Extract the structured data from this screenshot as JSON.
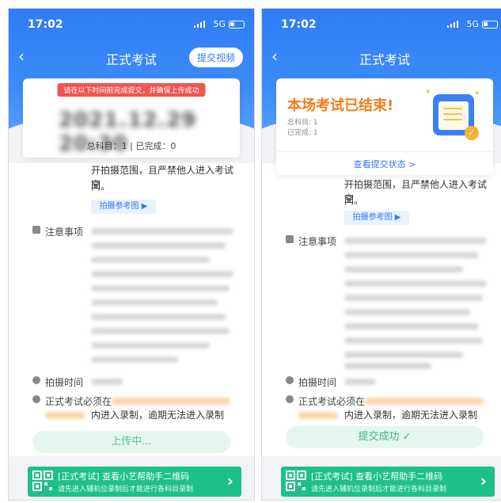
{
  "left": {
    "status_time": "17:02",
    "network": "5G",
    "nav_title": "正式考试",
    "submit_video_label": "提交视频",
    "notice": "请在以下时间前完成提交，并确保上传成功",
    "deadline_blurred": "2021.12.29 20:30",
    "counts": "总科目：1  |  已完成：0",
    "body_partial_line1": "开拍摄范围，且严禁他人进入考试空",
    "body_partial_line2": "间。",
    "ref_photo_label": "拍摄参考图 ▶",
    "notes_label": "注意事项",
    "shoot_time_label": "拍摄时间",
    "must_label": "正式考试必须在",
    "must_tail": "内进入录制，逾期无法进入录制",
    "action_label": "上传中...",
    "banner_title": "[正式考试] 查看小艺帮助手二维码",
    "banner_sub": "请先进入辅机位录制后才能进行各科目录制"
  },
  "right": {
    "status_time": "17:02",
    "network": "5G",
    "nav_title": "正式考试",
    "ended_title": "本场考试已结束!",
    "total_label": "总科目: 1",
    "done_label": "已完成: 1",
    "status_link": "查看提交状态 >",
    "body_partial_line1": "开拍摄范围，且严禁他人进入考试空",
    "body_partial_line2": "间。",
    "ref_photo_label": "拍摄参考图 ▶",
    "notes_label": "注意事项",
    "shoot_time_label": "拍摄时间",
    "must_label": "正式考试必须在",
    "must_tail": "内进入录制，逾期无法进入录制",
    "action_label": "提交成功 ✓",
    "banner_title": "[正式考试] 查看小艺帮助手二维码",
    "banner_sub": "请先进入辅机位录制后才能进行各科目录制"
  },
  "colors": {
    "brand_blue": "#2f7cf6",
    "success_green": "#1ec089",
    "warning_orange": "#f07d1a",
    "notice_red": "#f0554f"
  }
}
